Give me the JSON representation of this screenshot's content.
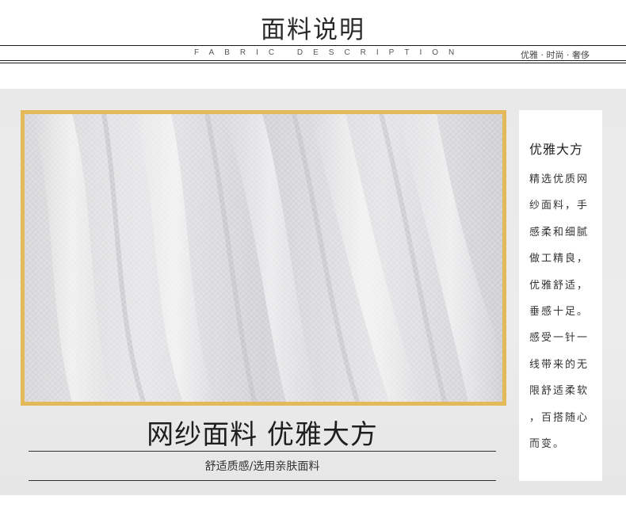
{
  "header": {
    "title": "面料说明",
    "subtitle": "FABRIC DESCRIPTION",
    "tagline": "优雅 · 时尚 · 奢侈"
  },
  "main": {
    "headline": "网纱面料 优雅大方",
    "caption": "舒适质感/选用亲肤面料",
    "frame_color": "#e3b95a"
  },
  "side": {
    "title": "优雅大方",
    "lines": [
      "精选优质网",
      "纱面料，手",
      "感柔和细腻",
      "做工精良，",
      "优雅舒适，",
      "垂感十足。",
      "感受一针一",
      "线带来的无",
      "限舒适柔软",
      "，百搭随心",
      "而变。"
    ]
  }
}
